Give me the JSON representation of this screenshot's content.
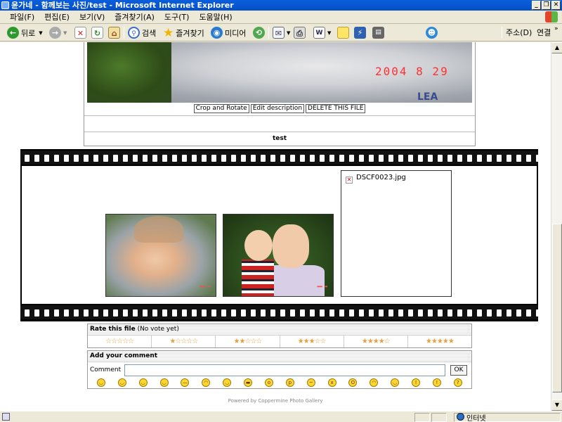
{
  "window": {
    "title": "윤가네 - 함께보는 사진/test - Microsoft Internet Explorer"
  },
  "menu": {
    "items": [
      "파일(F)",
      "편집(E)",
      "보기(V)",
      "즐겨찾기(A)",
      "도구(T)",
      "도움말(H)"
    ]
  },
  "toolbar": {
    "back_label": "뒤로",
    "search_label": "검색",
    "favorites_label": "즐겨찾기",
    "media_label": "미디어",
    "address_label": "주소(D)",
    "links_label": "연결"
  },
  "photo": {
    "date_stamp": "2004 8 29",
    "shirt_text": "LEA",
    "buttons": {
      "crop_rotate": "Crop and Rotate",
      "edit_description": "Edit description",
      "delete_file": "DELETE THIS FILE"
    },
    "caption": "test"
  },
  "filmstrip": {
    "missing_filename": "DSCF0023.jpg"
  },
  "rating": {
    "title": "Rate this file",
    "status": "(No vote yet)",
    "options": [
      "☆☆☆☆☆",
      "★☆☆☆☆",
      "★★☆☆☆",
      "★★★☆☆",
      "★★★★☆",
      "★★★★★"
    ]
  },
  "comment": {
    "title": "Add your comment",
    "label": "Comment",
    "value": "",
    "ok_label": "OK"
  },
  "footer": {
    "powered_by": "Powered by Coppermine Photo Gallery"
  },
  "statusbar": {
    "zone": "인터넷"
  }
}
